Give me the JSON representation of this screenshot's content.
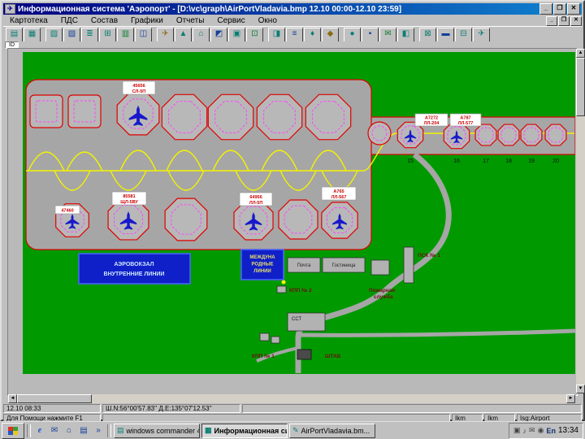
{
  "window": {
    "title": "Информационная система 'Аэропорт' - [D:\\vc\\graph\\AirPortVladavia.bmp 12.10 00:00-12.10 23:59]",
    "controls": {
      "minimize": "_",
      "maximize": "❐",
      "close": "✕"
    }
  },
  "menu": {
    "items": [
      "Картотека",
      "ПДС",
      "Состав",
      "Графики",
      "Отчеты",
      "Сервис",
      "Окно"
    ]
  },
  "toolbar": {
    "buttons": [
      {
        "glyph": "▤"
      },
      {
        "glyph": "▦"
      },
      {
        "glyph": "▨"
      },
      {
        "glyph": "▧"
      },
      {
        "glyph": "≣"
      },
      {
        "glyph": "⊞"
      },
      {
        "glyph": "▥"
      },
      {
        "glyph": "◫"
      },
      {
        "glyph": "✈"
      },
      {
        "glyph": "▲"
      },
      {
        "glyph": "⌂"
      },
      {
        "glyph": "◩"
      },
      {
        "glyph": "▣"
      },
      {
        "glyph": "⊡"
      },
      {
        "glyph": "◨"
      },
      {
        "glyph": "≡"
      },
      {
        "glyph": "♦"
      },
      {
        "glyph": "◆"
      },
      {
        "glyph": "●"
      },
      {
        "glyph": "▪"
      },
      {
        "glyph": "✉"
      },
      {
        "glyph": "◧"
      },
      {
        "glyph": "⊠"
      },
      {
        "glyph": "▬"
      },
      {
        "glyph": "⊟"
      },
      {
        "glyph": "✈"
      }
    ]
  },
  "idbar": {
    "label": "ID"
  },
  "map": {
    "stand_numbers": [
      "15",
      "16",
      "17",
      "18",
      "19",
      "20"
    ],
    "aircraft_labels": [
      {
        "line1": "45656",
        "line2": "СЛ-5П"
      },
      {
        "line1": "47460",
        "line2": ""
      },
      {
        "line1": "85581",
        "line2": "ЩЛ-5ВУ"
      },
      {
        "line1": "64956",
        "line2": "ЛЛ-5П"
      },
      {
        "line1": "А765",
        "line2": "ЛЛ-567"
      },
      {
        "line1": "А7272",
        "line2": "ЛЛ-204"
      },
      {
        "line1": "А787",
        "line2": "ЛЛ-577"
      }
    ],
    "buildings": {
      "terminal_domestic": {
        "line1": "АЭРОВОКЗАЛ",
        "line2": "ВНУТРЕННИЕ ЛИНИИ"
      },
      "terminal_intl": {
        "line1": "МЕЖДУНА",
        "line2": "РОДНЫЕ",
        "line3": "ЛИНИИ"
      },
      "post": {
        "label": "Почта"
      },
      "hotel": {
        "label": "Гостиница"
      },
      "psk": {
        "label": "ПСК № 1"
      },
      "kpp2": {
        "label": "КПП № 2"
      },
      "fire": {
        "line1": "Пожарная",
        "line2": "служба"
      },
      "sst": {
        "label": "ССТ"
      },
      "kpp1": {
        "label": "КПП № 1"
      },
      "shtab": {
        "label": "ШТАБ"
      }
    },
    "colors": {
      "grass": "#009a00",
      "apron": "#a6a6a6",
      "stand": "#b8b8b8",
      "stand_outline": "#e00000",
      "guide_line": "#f4f400",
      "terminal": "#1020c8",
      "aircraft": "#1818cc",
      "label_text": "#cc0000"
    }
  },
  "status": {
    "row1": {
      "time": "12.10 08:33",
      "coords": "Ш.N:56°00'57.83''  Д.E:135°07'12.53''"
    },
    "row2": {
      "help": "Для Помощи нажмите F1",
      "cell1": "Ikm",
      "cell2": "Ikm",
      "cell3": "Isg:Airport"
    }
  },
  "taskbar": {
    "quick": [
      {
        "glyph": "e"
      },
      {
        "glyph": "✉"
      },
      {
        "glyph": "⌂"
      },
      {
        "glyph": "▤"
      },
      {
        "glyph": "»"
      }
    ],
    "buttons": [
      {
        "icon": "▤",
        "label": "windows commander 4..."
      },
      {
        "icon": "▦",
        "label": "Информационная сис..."
      },
      {
        "icon": "✎",
        "label": "AirPortVladavia.bm..."
      }
    ],
    "tray": {
      "icons": [
        "▣",
        "♪",
        "✉",
        "◉"
      ],
      "lang": "En",
      "time": "13:34"
    }
  }
}
